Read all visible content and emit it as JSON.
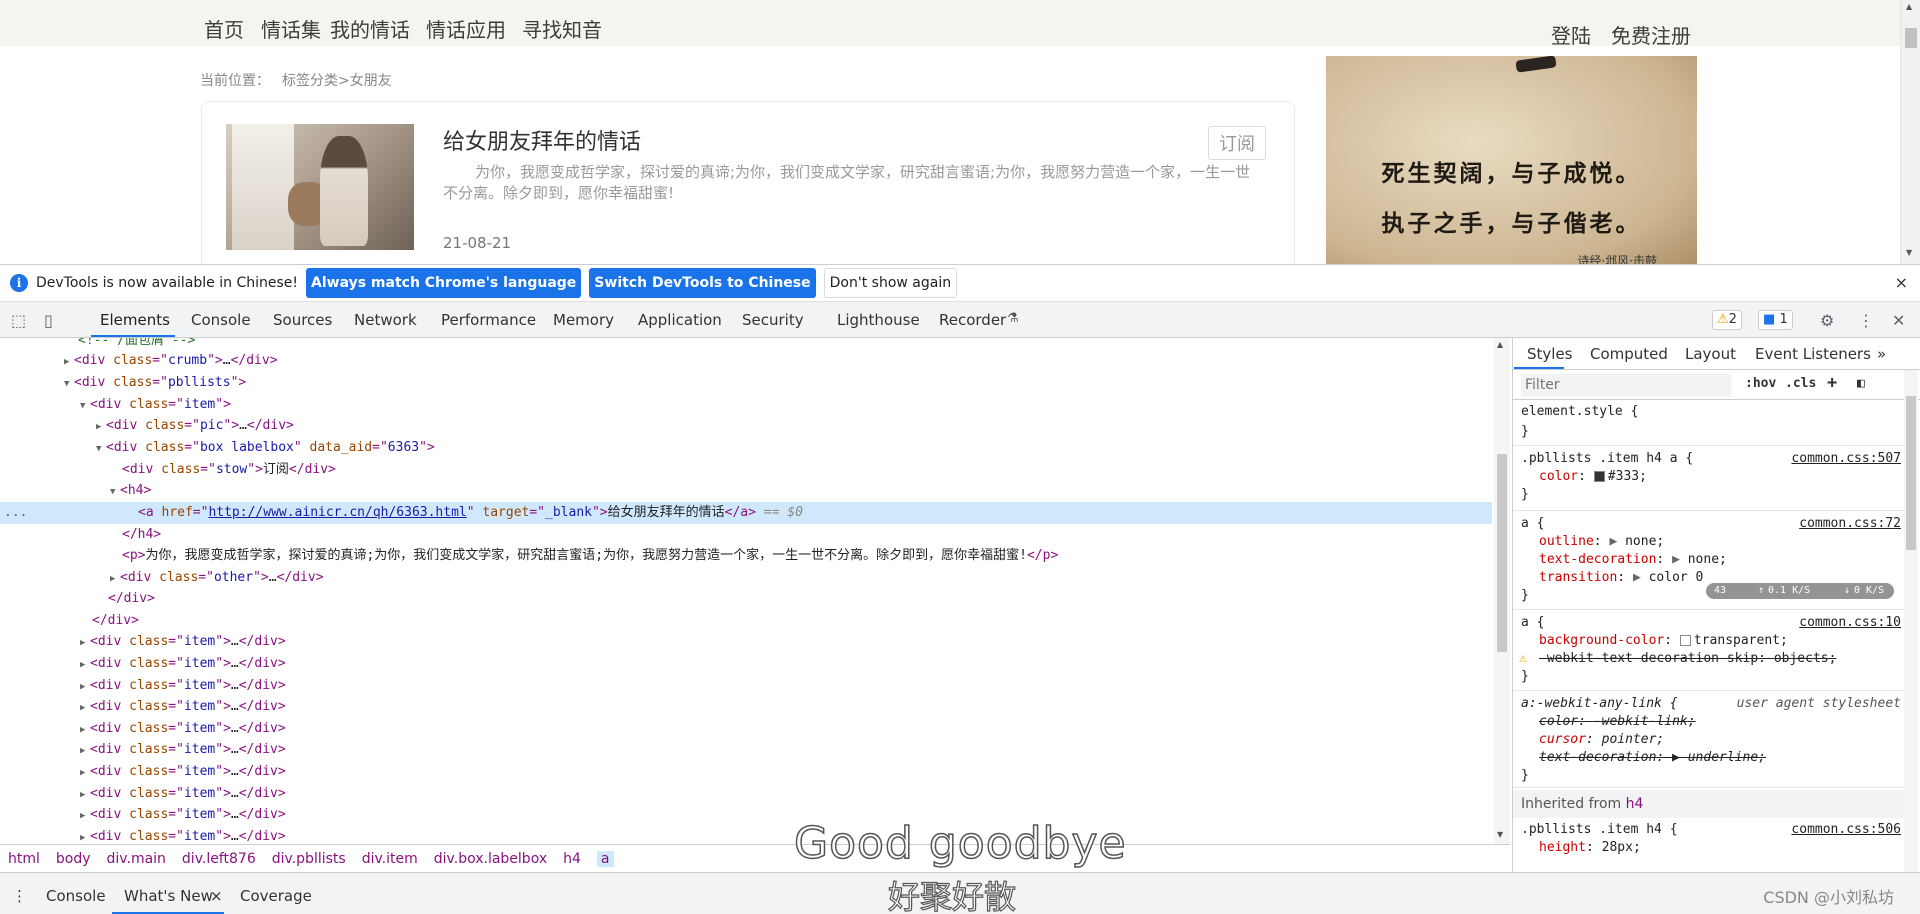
{
  "site": {
    "nav": [
      "首页",
      "情话集",
      "我的情话",
      "情话应用",
      "寻找知音"
    ],
    "nav_right": [
      "登陆",
      "免费注册"
    ],
    "crumb_prefix": "当前位置：",
    "crumb_path": "标签分类>女朋友",
    "card": {
      "title": "给女朋友拜年的情话",
      "stow": "订阅",
      "desc": "为你，我愿变成哲学家，探讨爱的真谛;为你，我们变成文学家，研究甜言蜜语;为你，我愿努力营造一个家，一生一世不分离。除夕即到，愿你幸福甜蜜!",
      "date": "21-08-21"
    },
    "banner": {
      "line1": "死生契阔，与子成悦。",
      "line2": "执子之手，与子偕老。",
      "line3": "诗经·邶风·击鼓"
    }
  },
  "infobar": {
    "message": "DevTools is now available in Chinese!",
    "btn_match": "Always match Chrome's language",
    "btn_switch": "Switch DevTools to Chinese",
    "btn_dismiss": "Don't show again",
    "close": "×"
  },
  "tabs": [
    "Elements",
    "Console",
    "Sources",
    "Network",
    "Performance",
    "Memory",
    "Application",
    "Security",
    "Lighthouse",
    "Recorder"
  ],
  "badges": {
    "warnings": "2",
    "messages": "1"
  },
  "dom": {
    "comment": "<!-- /面包屑 -->",
    "crumb_class": "crumb",
    "pbllists_class": "pbllists",
    "item_class": "item",
    "pic_class": "pic",
    "box_class": "box labelbox",
    "data_aid": "6363",
    "stow_class": "stow",
    "stow_text": "订阅",
    "href": "http://www.ainicr.cn/qh/6363.html",
    "target": "_blank",
    "link_text": "给女朋友拜年的情话",
    "eq": "== $0",
    "p_text": "为你，我愿变成哲学家，探讨爱的真谛;为你，我们变成文学家，研究甜言蜜语;为你，我愿努力营造一个家，一生一世不分离。除夕即到，愿你幸福甜蜜!",
    "other_class": "other",
    "ellipsis": "…",
    "dots": "..."
  },
  "breadcrumbs": [
    "html",
    "body",
    "div.main",
    "div.left876",
    "div.pbllists",
    "div.item",
    "div.box.labelbox",
    "h4",
    "a"
  ],
  "styles": {
    "tabs": [
      "Styles",
      "Computed",
      "Layout",
      "Event Listeners"
    ],
    "more": "»",
    "filter_placeholder": "Filter",
    "hov": ":hov",
    "cls": ".cls",
    "plus": "+",
    "rules": [
      {
        "selector": "element.style {",
        "source": ""
      },
      {
        "selector": ".pbllists .item h4 a {",
        "source": "common.css:507",
        "decls": [
          [
            "color",
            "#333"
          ]
        ]
      },
      {
        "selector": "a {",
        "source": "common.css:72",
        "decls": [
          [
            "outline",
            "none"
          ],
          [
            "text-decoration",
            "none"
          ],
          [
            "transition",
            "color 0"
          ]
        ]
      },
      {
        "selector": "a {",
        "source": "common.css:10",
        "decls": [
          [
            "background-color",
            "transparent"
          ],
          [
            "-webkit-text-decoration-skip",
            "objects"
          ]
        ]
      },
      {
        "selector": "a:-webkit-any-link {",
        "source": "user agent stylesheet",
        "decls": [
          [
            "color",
            "-webkit-link"
          ],
          [
            "cursor",
            "pointer"
          ],
          [
            "text-decoration",
            "underline"
          ]
        ]
      }
    ],
    "inherited_label": "Inherited from",
    "inherited_tag": "h4",
    "last_rule": {
      "selector": ".pbllists .item h4 {",
      "source": "common.css:506",
      "decls": [
        [
          "height",
          "28px"
        ]
      ]
    },
    "net_readout": {
      "pct": "43",
      "up": "0.1 K/S",
      "down": "0 K/S"
    }
  },
  "drawer": {
    "tabs": [
      "Console",
      "What's New",
      "Coverage"
    ],
    "close": "×"
  },
  "overlay": {
    "subtitle_en": "Good goodbye",
    "subtitle_zh": "好聚好散",
    "watermark": "CSDN @小刘私坊"
  },
  "colors": {
    "accent": "#1a73e8",
    "tag": "#881280",
    "attr": "#994500",
    "value": "#1a1aa6",
    "prop": "#c80000"
  }
}
